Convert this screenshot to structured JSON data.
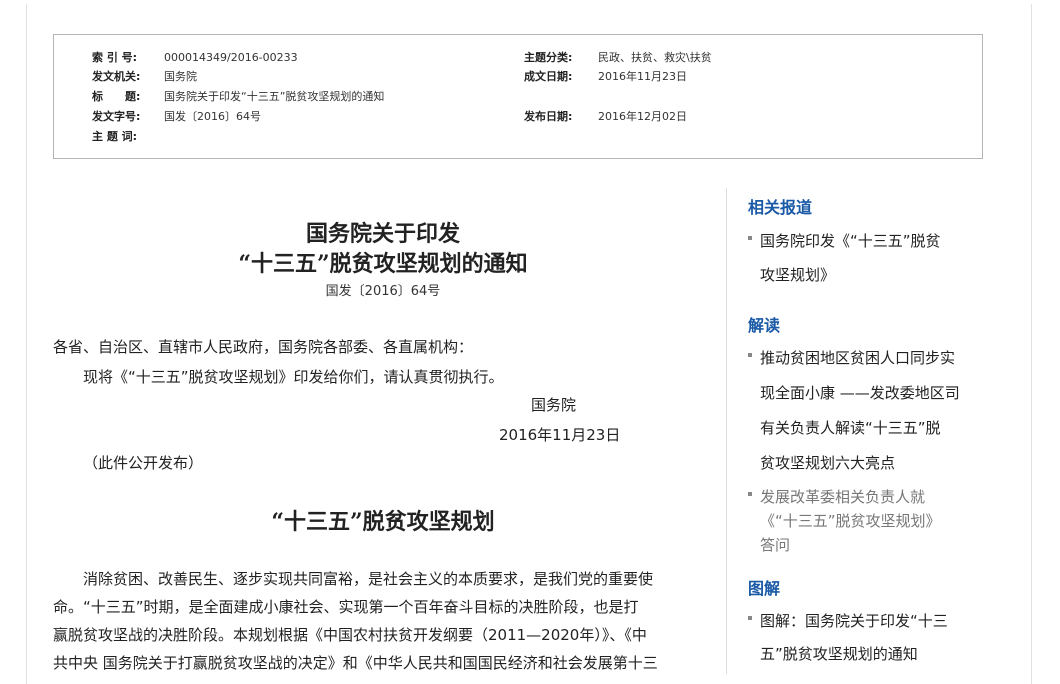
{
  "meta": {
    "index_label": "索 引 号:",
    "index_value": "000014349/2016-00233",
    "theme_label": "主题分类:",
    "theme_value": "民政、扶贫、救灾\\扶贫",
    "issuer_label": "发文机关:",
    "issuer_value": "国务院",
    "date_written_label": "成文日期:",
    "date_written_value": "2016年11月23日",
    "title_label": "标　　题:",
    "title_value": "国务院关于印发“十三五”脱贫攻坚规划的通知",
    "doc_no_label": "发文字号:",
    "doc_no_value": "国发〔2016〕64号",
    "publish_label": "发布日期:",
    "publish_value": "2016年12月02日",
    "keywords_label": "主 题 词:"
  },
  "article": {
    "title_line1": "国务院关于印发",
    "title_line2": "“十三五”脱贫攻坚规划的通知",
    "doc_number": "国发〔2016〕64号",
    "salutation": "各省、自治区、直辖市人民政府，国务院各部委、各直属机构：",
    "intro": "现将《“十三五”脱贫攻坚规划》印发给你们，请认真贯彻执行。",
    "signer": "国务院",
    "sign_date": "2016年11月23日",
    "public_note": "（此件公开发布）",
    "plan_title": "“十三五”脱贫攻坚规划",
    "body_lines": [
      "　　消除贫困、改善民生、逐步实现共同富裕，是社会主义的本质要求，是我们党的重要使",
      "命。“十三五”时期，是全面建成小康社会、实现第一个百年奋斗目标的决胜阶段，也是打",
      "赢脱贫攻坚战的决胜阶段。本规划根据《中国农村扶贫开发纲要（2011—2020年）》、《中",
      "共中央 国务院关于打赢脱贫攻坚战的决定》和《中华人民共和国国民经济和社会发展第十三"
    ]
  },
  "sidebar": {
    "related_heading": "相关报道",
    "related_item_lines": [
      "国务院印发《“十三五”脱贫",
      "攻坚规划》"
    ],
    "interp_heading": "解读",
    "interp_item1_lines": [
      "推动贫困地区贫困人口同步实",
      "现全面小康 ——发改委地区司",
      "有关负责人解读“十三五”脱",
      "贫攻坚规划六大亮点"
    ],
    "interp_item2_lines": [
      "发展改革委相关负责人就",
      "《“十三五”脱贫攻坚规划》",
      "答问"
    ],
    "graphic_heading": "图解",
    "graphic_item_lines": [
      "图解：国务院关于印发“十三",
      "五”脱贫攻坚规划的通知"
    ]
  }
}
